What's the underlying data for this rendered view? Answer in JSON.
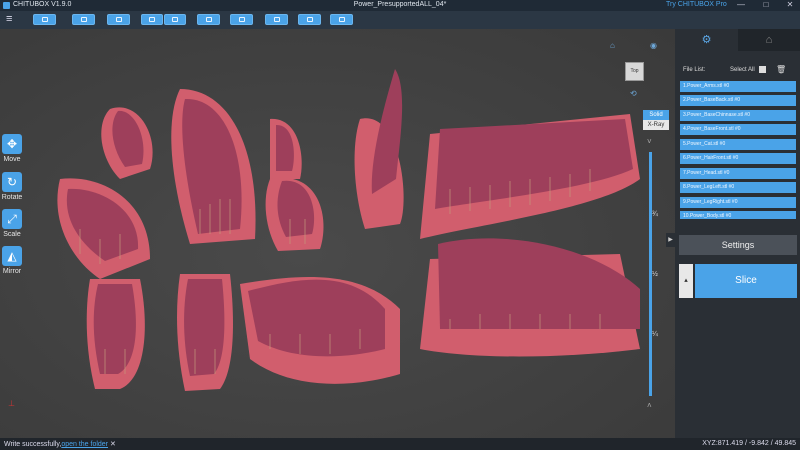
{
  "app": {
    "name": "CHITUBOX V1.9.0",
    "doc_title": "Power_PresupportedALL_04*",
    "try_pro": "Try CHITUBOX Pro"
  },
  "window_controls": [
    "—",
    "□",
    "✕"
  ],
  "toolbar": {
    "menu_icon": "hamburger-icon",
    "buttons": [
      "open-icon",
      "save-icon",
      "auto-layout-icon",
      "copy-icon",
      "mirror-icon",
      "settings-icon",
      "support-icon",
      "hollow-icon",
      "center-icon",
      "export-icon"
    ]
  },
  "left_tools": [
    {
      "label": "Move",
      "icon": "move-icon",
      "glyph": "✥"
    },
    {
      "label": "Rotate",
      "icon": "rotate-icon",
      "glyph": "↻"
    },
    {
      "label": "Scale",
      "icon": "scale-icon",
      "glyph": "⤢"
    },
    {
      "label": "Mirror",
      "icon": "mirror-icon",
      "glyph": "◭"
    }
  ],
  "viewport": {
    "cube_label": "Top",
    "mode_solid": "Solid",
    "mode_xray": "X-Ray",
    "ticks": [
      "¾",
      "½",
      "¼"
    ]
  },
  "panel": {
    "file_list_label": "File List:",
    "select_all": "Select All",
    "files": [
      "1.Power_Arms.stl #0",
      "2.Power_BaseBack.stl #0",
      "3.Power_BaseChinnase.stl #0",
      "4.Power_BaseFront.stl #0",
      "5.Power_Cat.stl #0",
      "6.Power_HairFront.stl #0",
      "7.Power_Head.stl #0",
      "8.Power_LegLeft.stl #0",
      "9.Power_LegRight.stl #0",
      "10.Power_Body.stl #0"
    ],
    "settings_label": "Settings",
    "slice_label": "Slice"
  },
  "status": {
    "message": "Write successfully,",
    "link": "open the folder",
    "coords": "XYZ:871.419 / -9.842 / 49.845"
  },
  "colors": {
    "accent": "#4aa3e8",
    "model": "#b14a67",
    "raft": "#d96070"
  }
}
